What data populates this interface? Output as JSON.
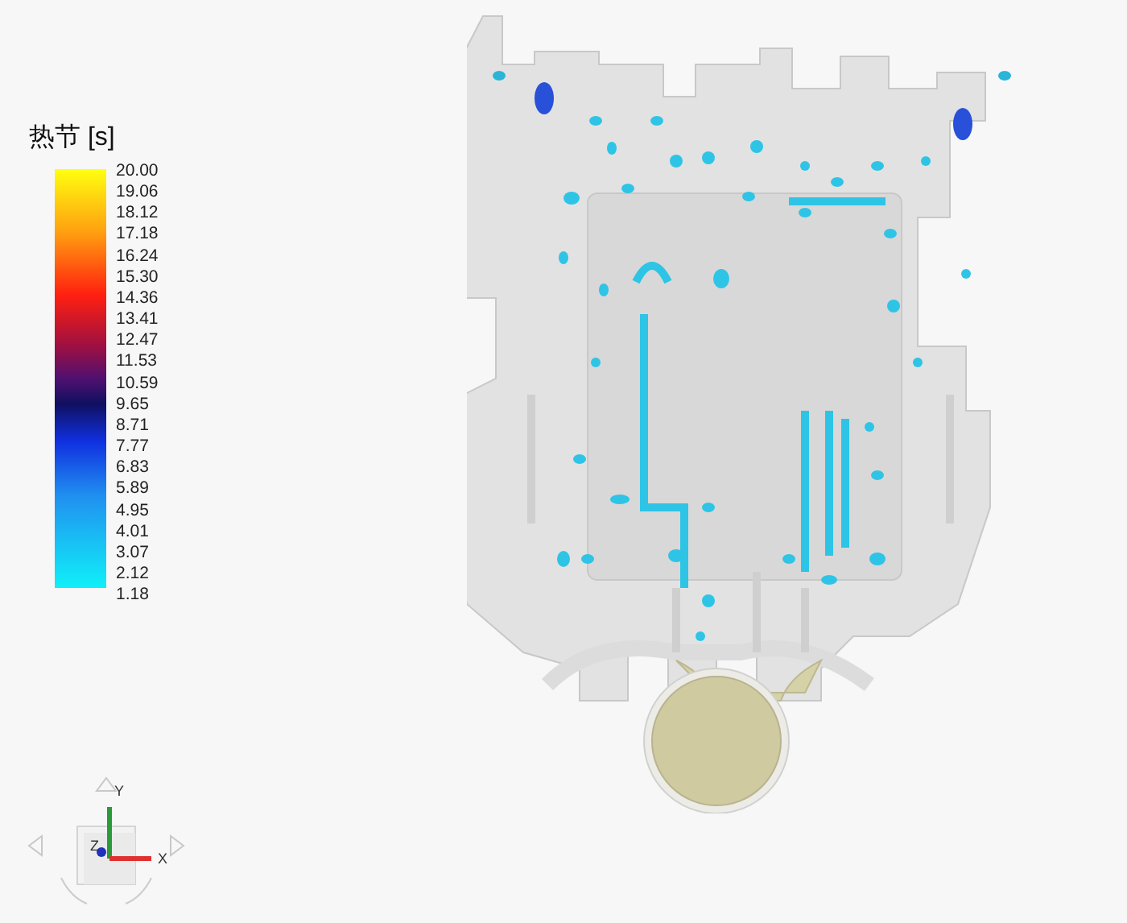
{
  "legend": {
    "title": "热节 [s]",
    "ticks": [
      "20.00",
      "19.06",
      "18.12",
      "17.18",
      "16.24",
      "15.30",
      "14.36",
      "13.41",
      "12.47",
      "11.53",
      "10.59",
      "9.65",
      "8.71",
      "7.77",
      "6.83",
      "5.89",
      "4.95",
      "4.01",
      "3.07",
      "2.12",
      "1.18"
    ]
  },
  "view_cube": {
    "axes": [
      {
        "kind": "y",
        "label": "Y"
      },
      {
        "kind": "x",
        "label": "X"
      },
      {
        "kind": "z",
        "label": "Z"
      }
    ]
  }
}
